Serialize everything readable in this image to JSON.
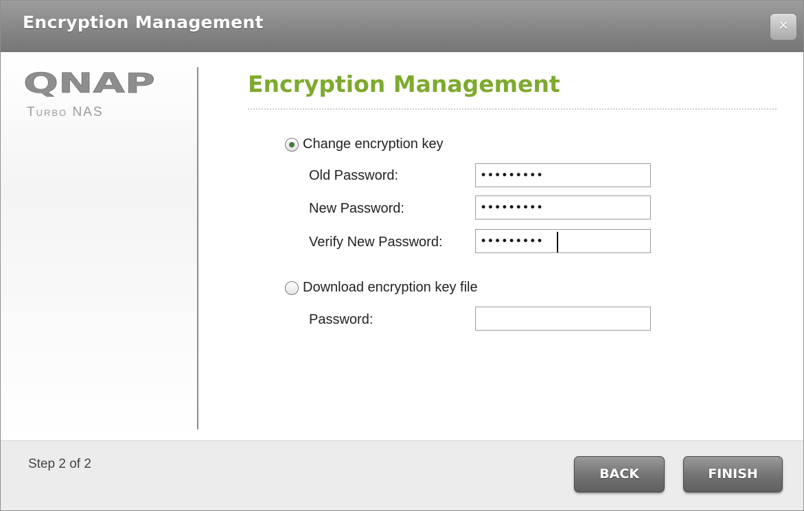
{
  "window": {
    "title": "Encryption Management",
    "close_label": "×"
  },
  "branding": {
    "logo_text": "QNAP",
    "subtitle": "Turbo NAS"
  },
  "main": {
    "heading": "Encryption Management",
    "options": [
      {
        "label": "Change encryption key",
        "selected": true
      },
      {
        "label": "Download encryption key file",
        "selected": false
      }
    ],
    "change_key": {
      "old_password_label": "Old Password:",
      "old_password_value": "•••••••••",
      "new_password_label": "New Password:",
      "new_password_value": "•••••••••",
      "verify_password_label": "Verify New Password:",
      "verify_password_value": "•••••••••"
    },
    "download_key": {
      "password_label": "Password:",
      "password_value": ""
    }
  },
  "footer": {
    "step_text": "Step 2 of 2",
    "back_label": "BACK",
    "finish_label": "FINISH"
  },
  "colors": {
    "heading_green": "#7daa2e",
    "titlebar_gray": "#8a8a8a",
    "button_gray": "#6f6f6f"
  }
}
